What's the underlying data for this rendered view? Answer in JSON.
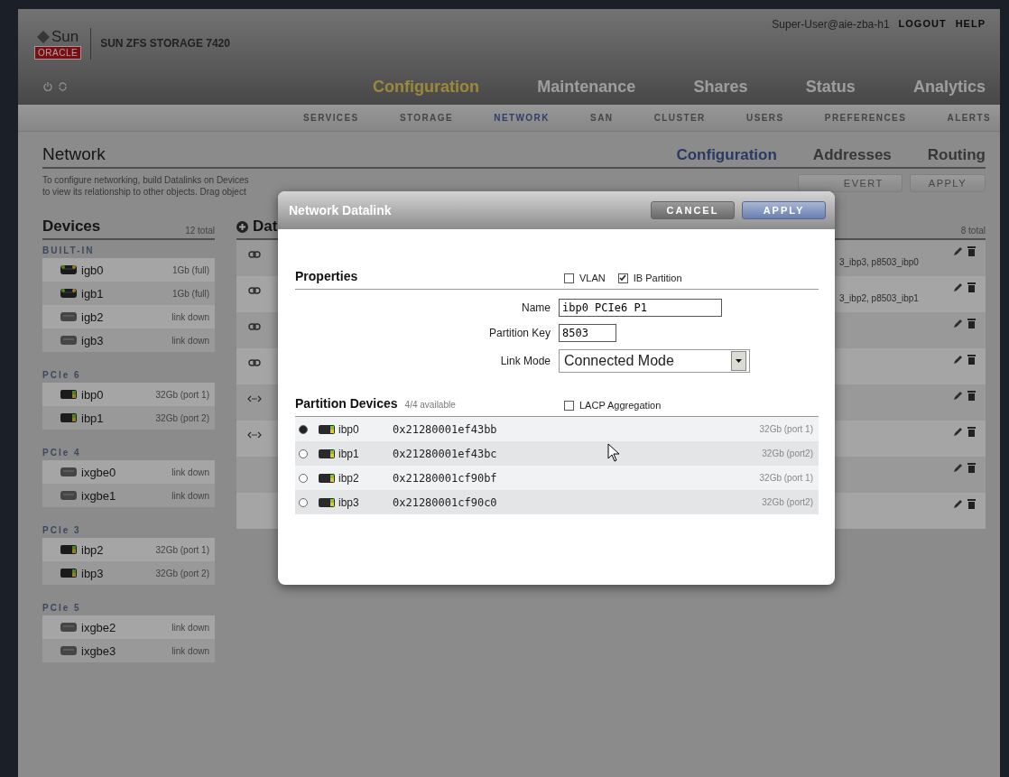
{
  "header": {
    "brand": "Sun",
    "badge": "ORACLE",
    "product": "SUN ZFS STORAGE 7420",
    "user": "Super-User@aie-zba-h1",
    "links": [
      "LOGOUT",
      "HELP"
    ]
  },
  "main_nav": [
    {
      "label": "Configuration",
      "selected": true
    },
    {
      "label": "Maintenance",
      "selected": false
    },
    {
      "label": "Shares",
      "selected": false
    },
    {
      "label": "Status",
      "selected": false
    },
    {
      "label": "Analytics",
      "selected": false
    }
  ],
  "sub_nav": [
    {
      "label": "SERVICES",
      "selected": false
    },
    {
      "label": "STORAGE",
      "selected": false
    },
    {
      "label": "NETWORK",
      "selected": true
    },
    {
      "label": "SAN",
      "selected": false
    },
    {
      "label": "CLUSTER",
      "selected": false
    },
    {
      "label": "USERS",
      "selected": false
    },
    {
      "label": "PREFERENCES",
      "selected": false
    },
    {
      "label": "ALERTS",
      "selected": false
    }
  ],
  "page": {
    "title": "Network",
    "description": [
      "To configure networking, build Datalinks on Devices",
      "to view its relationship to other objects.  Drag object"
    ],
    "tabs": [
      {
        "label": "Configuration",
        "selected": true
      },
      {
        "label": "Addresses",
        "selected": false
      },
      {
        "label": "Routing",
        "selected": false
      }
    ],
    "buttons": [
      "EVERT",
      "APPLY"
    ]
  },
  "devices": {
    "title": "Devices",
    "total": "12 total",
    "groups": [
      {
        "label": "BUILT-IN",
        "devices": [
          {
            "name": "igb0",
            "speed": "1Gb (full)",
            "kind": "ethernet",
            "up": true
          },
          {
            "name": "igb1",
            "speed": "1Gb (full)",
            "kind": "ethernet",
            "up": true
          },
          {
            "name": "igb2",
            "speed": "link down",
            "kind": "ethernet",
            "up": false
          },
          {
            "name": "igb3",
            "speed": "link down",
            "kind": "ethernet",
            "up": false
          }
        ]
      },
      {
        "label": "PCIe 6",
        "devices": [
          {
            "name": "ibp0",
            "speed": "32Gb (port 1)",
            "kind": "infiniband"
          },
          {
            "name": "ibp1",
            "speed": "32Gb (port 2)",
            "kind": "infiniband"
          }
        ]
      },
      {
        "label": "PCIe 4",
        "devices": [
          {
            "name": "ixgbe0",
            "speed": "link down",
            "kind": "ethernet",
            "up": false
          },
          {
            "name": "ixgbe1",
            "speed": "link down",
            "kind": "ethernet",
            "up": false
          }
        ]
      },
      {
        "label": "PCIe 3",
        "devices": [
          {
            "name": "ibp2",
            "speed": "32Gb (port 1)",
            "kind": "infiniband"
          },
          {
            "name": "ibp3",
            "speed": "32Gb (port 2)",
            "kind": "infiniband"
          }
        ]
      },
      {
        "label": "PCIe 5",
        "devices": [
          {
            "name": "ixgbe2",
            "speed": "link down",
            "kind": "ethernet",
            "up": false
          },
          {
            "name": "ixgbe3",
            "speed": "link down",
            "kind": "ethernet",
            "up": false
          }
        ]
      }
    ]
  },
  "datalinks": {
    "title": "Dat",
    "total": "8 total",
    "rows": [
      {
        "kind": "chain",
        "members": "3_ibp3, p8503_ibp0"
      },
      {
        "kind": "chain",
        "members": "3_ibp2, p8503_ibp1"
      },
      {
        "kind": "chain"
      },
      {
        "kind": "chain"
      },
      {
        "kind": "partition"
      },
      {
        "kind": "partition"
      },
      {
        "kind": "blank"
      },
      {
        "kind": "blank"
      }
    ]
  },
  "dialog": {
    "title": "Network Datalink",
    "buttons": [
      {
        "label": "CANCEL",
        "kind": "secondary"
      },
      {
        "label": "APPLY",
        "kind": "primary"
      }
    ],
    "properties": {
      "title": "Properties",
      "options": [
        {
          "label": "VLAN",
          "checked": false
        },
        {
          "label": "IB Partition",
          "checked": true
        }
      ],
      "fields": [
        {
          "label": "Name",
          "value": "ibp0 PCIe6 P1",
          "kind": "text"
        },
        {
          "label": "Partition Key",
          "value": "8503",
          "kind": "short"
        },
        {
          "label": "Link Mode",
          "value": "Connected Mode",
          "kind": "select"
        }
      ]
    },
    "partition_devices": {
      "title": "Partition Devices",
      "availability": "4/4 available",
      "aggregation": {
        "label": "LACP Aggregation",
        "checked": false
      },
      "rows": [
        {
          "selected": true,
          "name": "ibp0",
          "guid": "0x21280001ef43bb",
          "speed": "32Gb (port 1)"
        },
        {
          "selected": false,
          "name": "ibp1",
          "guid": "0x21280001ef43bc",
          "speed": "32Gb (port2)"
        },
        {
          "selected": false,
          "name": "ibp2",
          "guid": "0x21280001cf90bf",
          "speed": "32Gb (port 1)"
        },
        {
          "selected": false,
          "name": "ibp3",
          "guid": "0x21280001cf90c0",
          "speed": "32Gb (port2)"
        }
      ]
    }
  }
}
